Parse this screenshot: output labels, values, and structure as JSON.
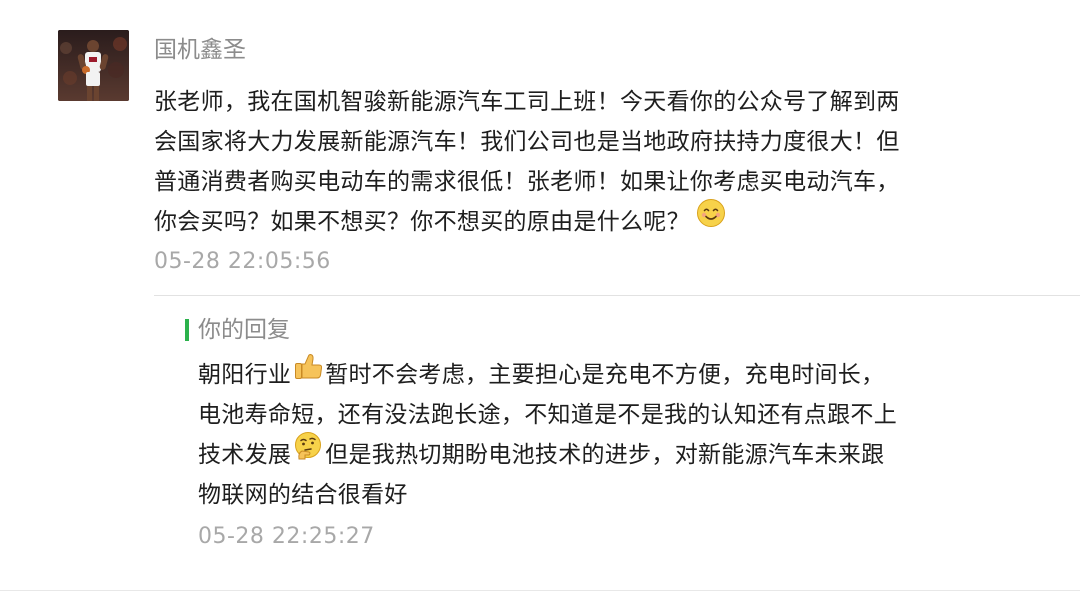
{
  "comment": {
    "avatar_icon": "player-avatar-icon",
    "username": "国机鑫圣",
    "text": "张老师，我在国机智骏新能源汽车工司上班！今天看你的公众号了解到两会国家将大力发展新能源汽车！我们公司也是当地政府扶持力度很大！但普通消费者购买电动车的需求很低！张老师！如果让你考虑买电动汽车，你会买吗？如果不想买？你不想买的原由是什么呢？",
    "line1": "张老师，我在国机智骏新能源汽车工司上班！今天看你的公众号了解到两",
    "line2": "会国家将大力发展新能源汽车！我们公司也是当地政府扶持力度很大！但",
    "line3": "普通消费者购买电动车的需求很低！张老师！如果让你考虑买电动汽车，",
    "line4": "你会买吗？如果不想买？你不想买的原由是什么呢？",
    "emoji": "smile-emoji-icon",
    "timestamp": "05-28 22:05:56"
  },
  "reply": {
    "title": "你的回复",
    "line1_a": "朝阳行业",
    "line1_emoji": "thumbs-up-emoji-icon",
    "line1_b": "暂时不会考虑，主要担心是充电不方便，充电时间长，",
    "line2": "电池寿命短，还有没法跑长途，不知道是不是我的认知还有点跟不上",
    "line3_a": "技术发展",
    "line3_emoji": "thinking-emoji-icon",
    "line3_b": "但是我热切期盼电池技术的进步，对新能源汽车未来跟",
    "line4": "物联网的结合很看好",
    "timestamp": "05-28 22:25:27",
    "accent_color": "#2bb24c"
  }
}
